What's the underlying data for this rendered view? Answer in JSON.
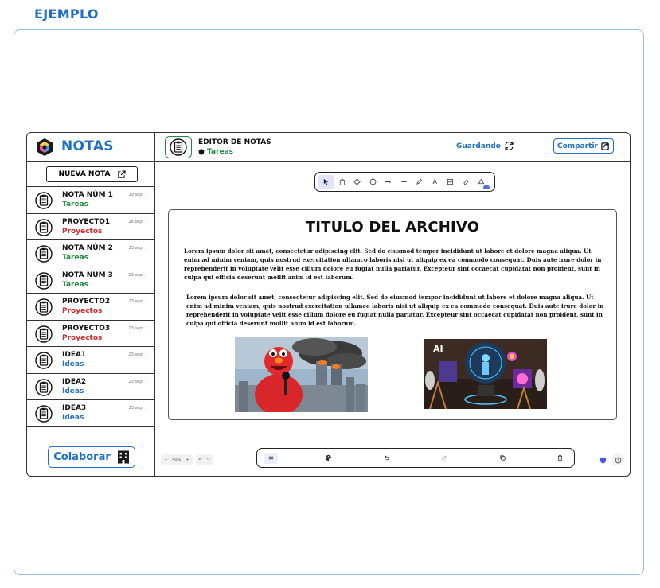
{
  "page": {
    "label": "EJEMPLO"
  },
  "app": {
    "brand": "NOTAS",
    "new_note": "NUEVA NOTA",
    "notes": [
      {
        "title": "NOTA NÚM 1",
        "category": "Tareas",
        "cat": "tareas",
        "date": "29 sept"
      },
      {
        "title": "PROYECTO1",
        "category": "Proyectos",
        "cat": "proyectos",
        "date": "26 sept"
      },
      {
        "title": "NOTA NÚM 2",
        "category": "Tareas",
        "cat": "tareas",
        "date": "23 sept"
      },
      {
        "title": "NOTA NÚM 3",
        "category": "Tareas",
        "cat": "tareas",
        "date": "23 sept"
      },
      {
        "title": "PROYECTO2",
        "category": "Proyectos",
        "cat": "proyectos",
        "date": "23 sept"
      },
      {
        "title": "PROYECTO3",
        "category": "Proyectos",
        "cat": "proyectos",
        "date": "23 sept"
      },
      {
        "title": "IDEA1",
        "category": "Ideas",
        "cat": "ideas",
        "date": "23 sept"
      },
      {
        "title": "IDEA2",
        "category": "Ideas",
        "cat": "ideas",
        "date": "23 sept"
      },
      {
        "title": "IDEA3",
        "category": "Ideas",
        "cat": "ideas",
        "date": "23 sept"
      }
    ],
    "collaborate": "Colaborar"
  },
  "header": {
    "title": "EDITOR DE NOTAS",
    "subtitle": "Tareas",
    "saving": "Guardando",
    "share": "Compartir"
  },
  "toolbar": {
    "tools": [
      "pointer-tool",
      "hand-tool",
      "diamond-tool",
      "circle-tool",
      "arrow-tool",
      "line-tool",
      "pencil-tool",
      "text-tool",
      "image-tool",
      "eraser-tool",
      "shapes-tool"
    ],
    "text_tool_glyph": "A"
  },
  "document": {
    "title": "TITULO DEL ARCHIVO",
    "paragraph1": "Lorem ipsum dolor sit amet, consectetur adipiscing elit. Sed do eiusmod tempor incididunt ut labore et dolore magna aliqua. Ut enim ad minim veniam, quis nostrud exercitation ullamco laboris nisi ut aliquip ex ea commodo consequat. Duis aute irure dolor in reprehenderit in voluptate velit esse cillum dolore eu fugiat nulla pariatur. Excepteur sint occaecat cupidatat non proident, sunt in culpa qui officia deserunt mollit anim id est laborum.",
    "paragraph2": "Lorem ipsum dolor sit amet, consectetur adipiscing elit. Sed do eiusmod tempor incididunt ut labore et dolore magna aliqua. Ut enim ad minim veniam, quis nostrud exercitation ullamco laboris nisi ut aliquip ex ea commodo consequat. Duis aute irure dolor in reprehenderit in voluptate velit esse cillum dolore eu fugiat nulla pariatur. Excepteur sint occaecat cupidatat non proident, sunt in culpa qui officia deserunt mollit anim id est laborum.",
    "image_ai_label": "AI"
  },
  "bottom": {
    "zoom_out": "−",
    "zoom_level": "40%",
    "zoom_in": "+",
    "undo": "↶",
    "redo": "↷"
  },
  "colors": {
    "brand_blue": "#1f6fc4",
    "tareas_green": "#1f8a3c",
    "proyectos_red": "#d22a2a",
    "tool_active": "#dfe3ff"
  }
}
